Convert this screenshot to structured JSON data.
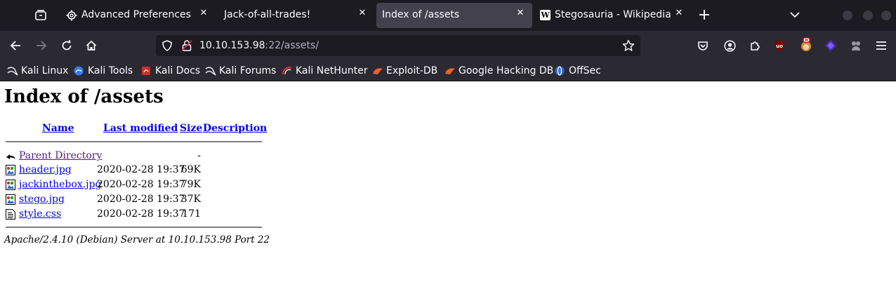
{
  "browser": {
    "tabs": [
      {
        "label": "Advanced Preferences",
        "icon": "gear-icon",
        "close": "✕"
      },
      {
        "label": "Jack-of-all-trades!",
        "icon": "",
        "close": "✕"
      },
      {
        "label": "Index of /assets",
        "icon": "",
        "close": "✕",
        "active": true
      },
      {
        "label": "Stegosauria - Wikipedia",
        "icon": "wikipedia-icon",
        "close": "✕"
      }
    ],
    "new_tab": "+",
    "url_host": "10.10.153.98",
    "url_rest": ":22/assets/",
    "colors": {
      "tabbar": "#1c1b22",
      "navbar": "#2b2a33",
      "active_tab": "#42414d",
      "text": "#fbfbfe"
    }
  },
  "bookmarks": [
    {
      "label": "Kali Linux",
      "icon": "kali-dragon-icon"
    },
    {
      "label": "Kali Tools",
      "icon": "kali-tools-icon"
    },
    {
      "label": "Kali Docs",
      "icon": "kali-docs-icon"
    },
    {
      "label": "Kali Forums",
      "icon": "kali-dragon-icon"
    },
    {
      "label": "Kali NetHunter",
      "icon": "nethunter-icon"
    },
    {
      "label": "Exploit-DB",
      "icon": "exploitdb-icon"
    },
    {
      "label": "Google Hacking DB",
      "icon": "exploitdb-icon"
    },
    {
      "label": "OffSec",
      "icon": "offsec-icon"
    }
  ],
  "page": {
    "title": "Index of /assets",
    "columns": {
      "name": "Name",
      "modified": "Last modified",
      "size": "Size",
      "description": "Description"
    },
    "rows": [
      {
        "name": "Parent Directory",
        "modified": "",
        "size": "-",
        "icon": "back-icon",
        "visited": true
      },
      {
        "name": "header.jpg",
        "modified": "2020-02-28 19:37",
        "size": "69K",
        "icon": "image-file-icon"
      },
      {
        "name": "jackinthebox.jpg",
        "modified": "2020-02-28 19:37",
        "size": "79K",
        "icon": "image-file-icon"
      },
      {
        "name": "stego.jpg",
        "modified": "2020-02-28 19:37",
        "size": "37K",
        "icon": "image-file-icon"
      },
      {
        "name": "style.css",
        "modified": "2020-02-28 19:37",
        "size": "171",
        "icon": "text-file-icon"
      }
    ],
    "footer": "Apache/2.4.10 (Debian) Server at 10.10.153.98 Port 22"
  }
}
